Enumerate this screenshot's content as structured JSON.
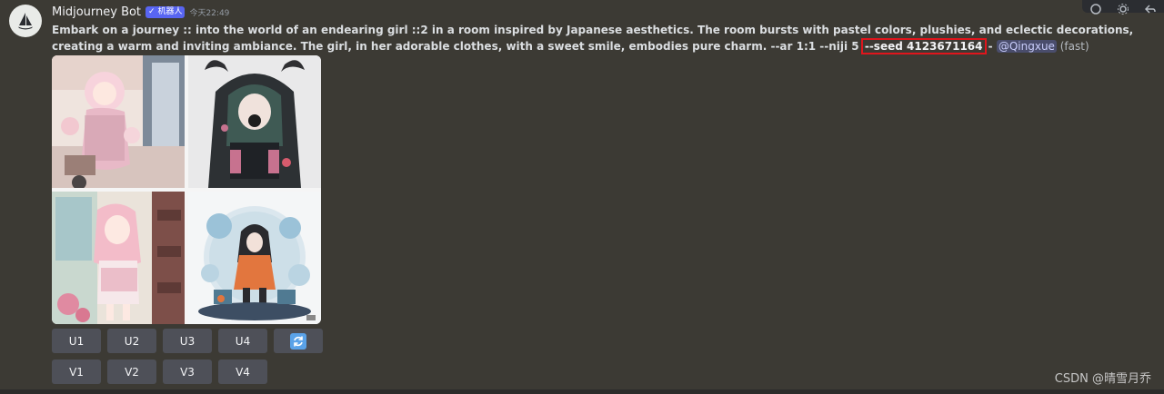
{
  "message": {
    "username": "Midjourney Bot",
    "badge": "✓ 机器人",
    "timestamp": "今天22:49",
    "prompt_text": "Embark on a journey :: into the world of an endearing girl ::2 in a room inspired by Japanese aesthetics. The room bursts with pastel colors, plushies, and eclectic decorations, creating a warm and inviting ambiance. The girl, in her adorable clothes, with a sweet smile, embodies pure charm. --ar 1:1 --niji 5 ",
    "seed": "--seed 4123671164",
    "separator": " - ",
    "mention": "@Qingxue",
    "speed": " (fast)"
  },
  "image_grid": {
    "tiles": [
      "tile-1",
      "tile-2",
      "tile-3",
      "tile-4"
    ]
  },
  "upscale_buttons": [
    "U1",
    "U2",
    "U3",
    "U4"
  ],
  "variation_buttons": [
    "V1",
    "V2",
    "V3",
    "V4"
  ],
  "reroll_icon": "refresh-icon",
  "top_actions_icons": [
    "emoji-icon",
    "settings-icon",
    "reply-icon"
  ],
  "watermark": "CSDN @晴雪月乔",
  "colors": {
    "background": "#3c3a34",
    "accent": "#5865f2",
    "highlight": "#e0151c",
    "button": "#4e5058",
    "reroll": "#5aa2e8"
  }
}
